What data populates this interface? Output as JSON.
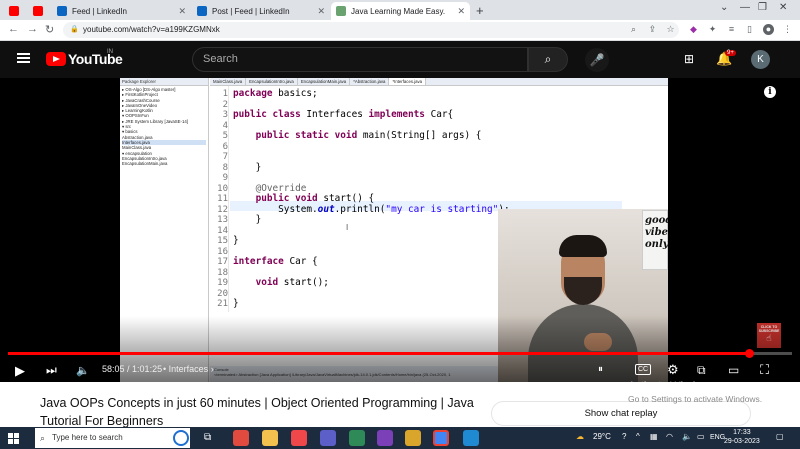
{
  "browser": {
    "tabs": [
      {
        "label": "",
        "icon": "youtube-favicon-icon",
        "color": "#ff0000"
      },
      {
        "label": "",
        "icon": "youtube-favicon-icon",
        "color": "#ff0000"
      },
      {
        "label": "Feed | LinkedIn",
        "icon": "linkedin-icon",
        "color": "#0a66c2"
      },
      {
        "label": "Post | Feed | LinkedIn",
        "icon": "linkedin-icon",
        "color": "#0a66c2"
      },
      {
        "label": "Java Learning Made Easy.",
        "icon": "site-icon",
        "color": "#6aa36f"
      }
    ],
    "url": "youtube.com/watch?v=a199KZGMNxk"
  },
  "youtube": {
    "logo_text": "YouTube",
    "region": "IN",
    "search_placeholder": "Search",
    "notification_count": "9+",
    "avatar_letter": "K"
  },
  "video": {
    "editor_tabs": [
      "MainClass.java",
      "EncapsulationIntro.java",
      "EncapsulationMain.java",
      "*Abstraction.java",
      "*Interfaces.java"
    ],
    "package_explorer_title": "Package Explorer",
    "tree": [
      "▸ OS-Algo [DS-Algo master]",
      "▸ FirstKotlinProject",
      "▸ JavaCrashCourse",
      "▸ JavaInOneVideo",
      "▸ LearningKotlin",
      "▾ OOPSInFun",
      "  ▸ JRE System Library [JavaSE-14]",
      "  ▾ src",
      "    ▾ basics",
      "      Abstraction.java",
      "      Interfaces.java",
      "      MainClass.java",
      "    ▾ encapsulation",
      "      EncapsulationIntro.java",
      "      EncapsulationMain.java"
    ],
    "line_numbers": [
      "1",
      "2",
      "3",
      "4",
      "5",
      "6",
      "7",
      "8",
      "9",
      "10",
      "11",
      "12",
      "13",
      "14",
      "15",
      "16",
      "17",
      "18",
      "19",
      "20",
      "21"
    ],
    "code_lines": [
      "package basics;",
      "",
      "public class Interfaces implements Car{",
      "",
      "    public static void main(String[] args) {",
      "",
      "",
      "    }",
      "",
      "    @Override",
      "    public void start() {",
      "        System.out.println(\"my car is starting\");",
      "    }",
      "",
      "}",
      "",
      "interface Car {",
      "",
      "    void start();",
      "",
      "}"
    ],
    "console_text": "<terminated> Abstraction [Java Application] /Library/Java/JavaVirtualMachines/jdk-14.0.1.jdk/Contents/Home/bin/java (25-Oct-2020, 1",
    "console_label": "Console",
    "poster_text": "good vibes only",
    "subscribe_label": "CLICK TO SUBSCRIBE"
  },
  "player": {
    "current_time": "58:05",
    "duration": "1:01:25",
    "chapter": "Interfaces",
    "progress_played": 0.9457,
    "progress_buffered": 0.95,
    "activate_title": "Activate Windows",
    "activate_sub": "Go to Settings to activate Windows."
  },
  "page": {
    "title": "Java OOPs Concepts in just 60 minutes | Object Oriented Programming | Java Tutorial For Beginners",
    "show_chat": "Show chat replay"
  },
  "taskbar": {
    "search_placeholder": "Type here to search",
    "weather": "29°C",
    "language": "ENG",
    "time": "17:33",
    "date": "29-03-2023"
  }
}
